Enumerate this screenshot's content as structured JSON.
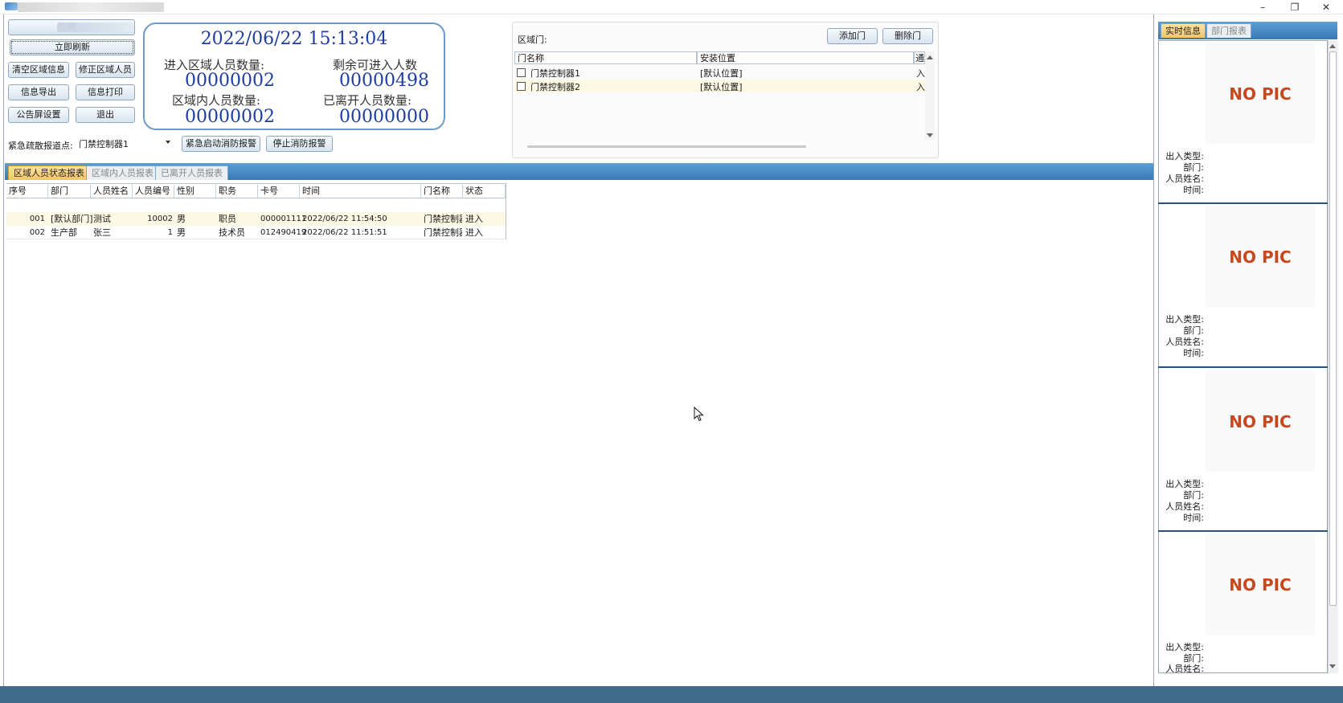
{
  "window": {
    "minimize": "–",
    "restore": "❐",
    "close": "✕"
  },
  "left_buttons": {
    "blurred": "界",
    "refresh": "立即刷新",
    "clear_region": "清空区域信息",
    "fix_region": "修正区域人员",
    "export": "信息导出",
    "print": "信息打印",
    "notice_settings": "公告屏设置",
    "exit": "退出"
  },
  "clock": {
    "datetime": "2022/06/22  15:13:04",
    "enter_label": "进入区域人员数量:",
    "enter_value": "00000002",
    "remain_label": "剩余可进入人数",
    "remain_value": "00000498",
    "inside_label": "区域内人员数量:",
    "inside_value": "00000002",
    "left_label": "已离开人员数量:",
    "left_value": "00000000"
  },
  "emergency": {
    "label": "紧急疏散报道点:",
    "selected": "门禁控制器1",
    "start_btn": "紧急启动消防报警",
    "stop_btn": "停止消防报警"
  },
  "region_door": {
    "label": "区域门:",
    "add_btn": "添加门",
    "delete_btn": "删除门",
    "columns": [
      "门名称",
      "安装位置",
      "通"
    ],
    "rows": [
      {
        "name": "门禁控制器1",
        "location": "[默认位置]",
        "dir": "入"
      },
      {
        "name": "门禁控制器2",
        "location": "[默认位置]",
        "dir": "入"
      }
    ]
  },
  "tabs": [
    "区域人员状态报表",
    "区域内人员报表",
    "已离开人员报表"
  ],
  "table": {
    "columns": [
      "序号",
      "部门",
      "人员姓名",
      "人员编号",
      "性别",
      "职务",
      "卡号",
      "时间",
      "门名称",
      "状态"
    ],
    "rows": [
      {
        "no": "001",
        "dept": "[默认部门]",
        "name": "测试",
        "id": "10002",
        "sex": "男",
        "title": "职员",
        "card": "000001111",
        "time": "2022/06/22 11:54:50",
        "door": "门禁控制器",
        "status": "进入"
      },
      {
        "no": "002",
        "dept": "生产部",
        "name": "张三",
        "id": "1",
        "sex": "男",
        "title": "技术员",
        "card": "012490419",
        "time": "2022/06/22 11:51:51",
        "door": "门禁控制器",
        "status": "进入"
      }
    ]
  },
  "right_tabs": [
    "实时信息",
    "部门报表"
  ],
  "cards": [
    {
      "pic": "NO PIC",
      "labels": [
        "出入类型:",
        "部门:",
        "人员姓名:",
        "时间:"
      ]
    },
    {
      "pic": "NO PIC",
      "labels": [
        "出入类型:",
        "部门:",
        "人员姓名:",
        "时间:"
      ]
    },
    {
      "pic": "NO PIC",
      "labels": [
        "出入类型:",
        "部门:",
        "人员姓名:",
        "时间:"
      ]
    },
    {
      "pic": "NO PIC",
      "labels": [
        "出入类型:",
        "部门:",
        "人员姓名:"
      ]
    }
  ]
}
